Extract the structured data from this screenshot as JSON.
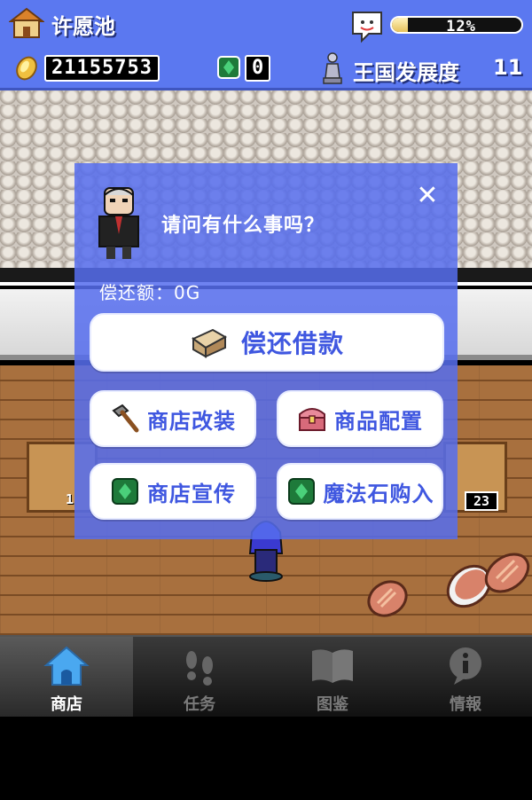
{
  "header": {
    "shop_name": "许愿池",
    "progress_percent": 12,
    "progress_text": "12%",
    "gold": "21155753",
    "gems": "0",
    "development_label": "王国发展度",
    "development_level": "11"
  },
  "scene": {
    "stock_left": "1",
    "stock_right": "23"
  },
  "dialog": {
    "question": "请问有什么事吗？",
    "close_label": "✕",
    "repay_amount_label": "偿还额：0G",
    "buttons": {
      "repay": "偿还借款",
      "renovate": "商店改装",
      "goods": "商品配置",
      "promotion": "商店宣传",
      "magic_stone": "魔法石购入"
    }
  },
  "tabs": [
    {
      "label": "商店",
      "icon": "house-icon",
      "active": true
    },
    {
      "label": "任务",
      "icon": "footprints-icon",
      "active": false
    },
    {
      "label": "图鉴",
      "icon": "book-icon",
      "active": false
    },
    {
      "label": "情報",
      "icon": "info-icon",
      "active": false
    }
  ],
  "colors": {
    "header_bg": "#5b78f0",
    "dialog_bg": "#566eee",
    "button_text": "#3f57e0",
    "tab_bg": "#222222"
  }
}
